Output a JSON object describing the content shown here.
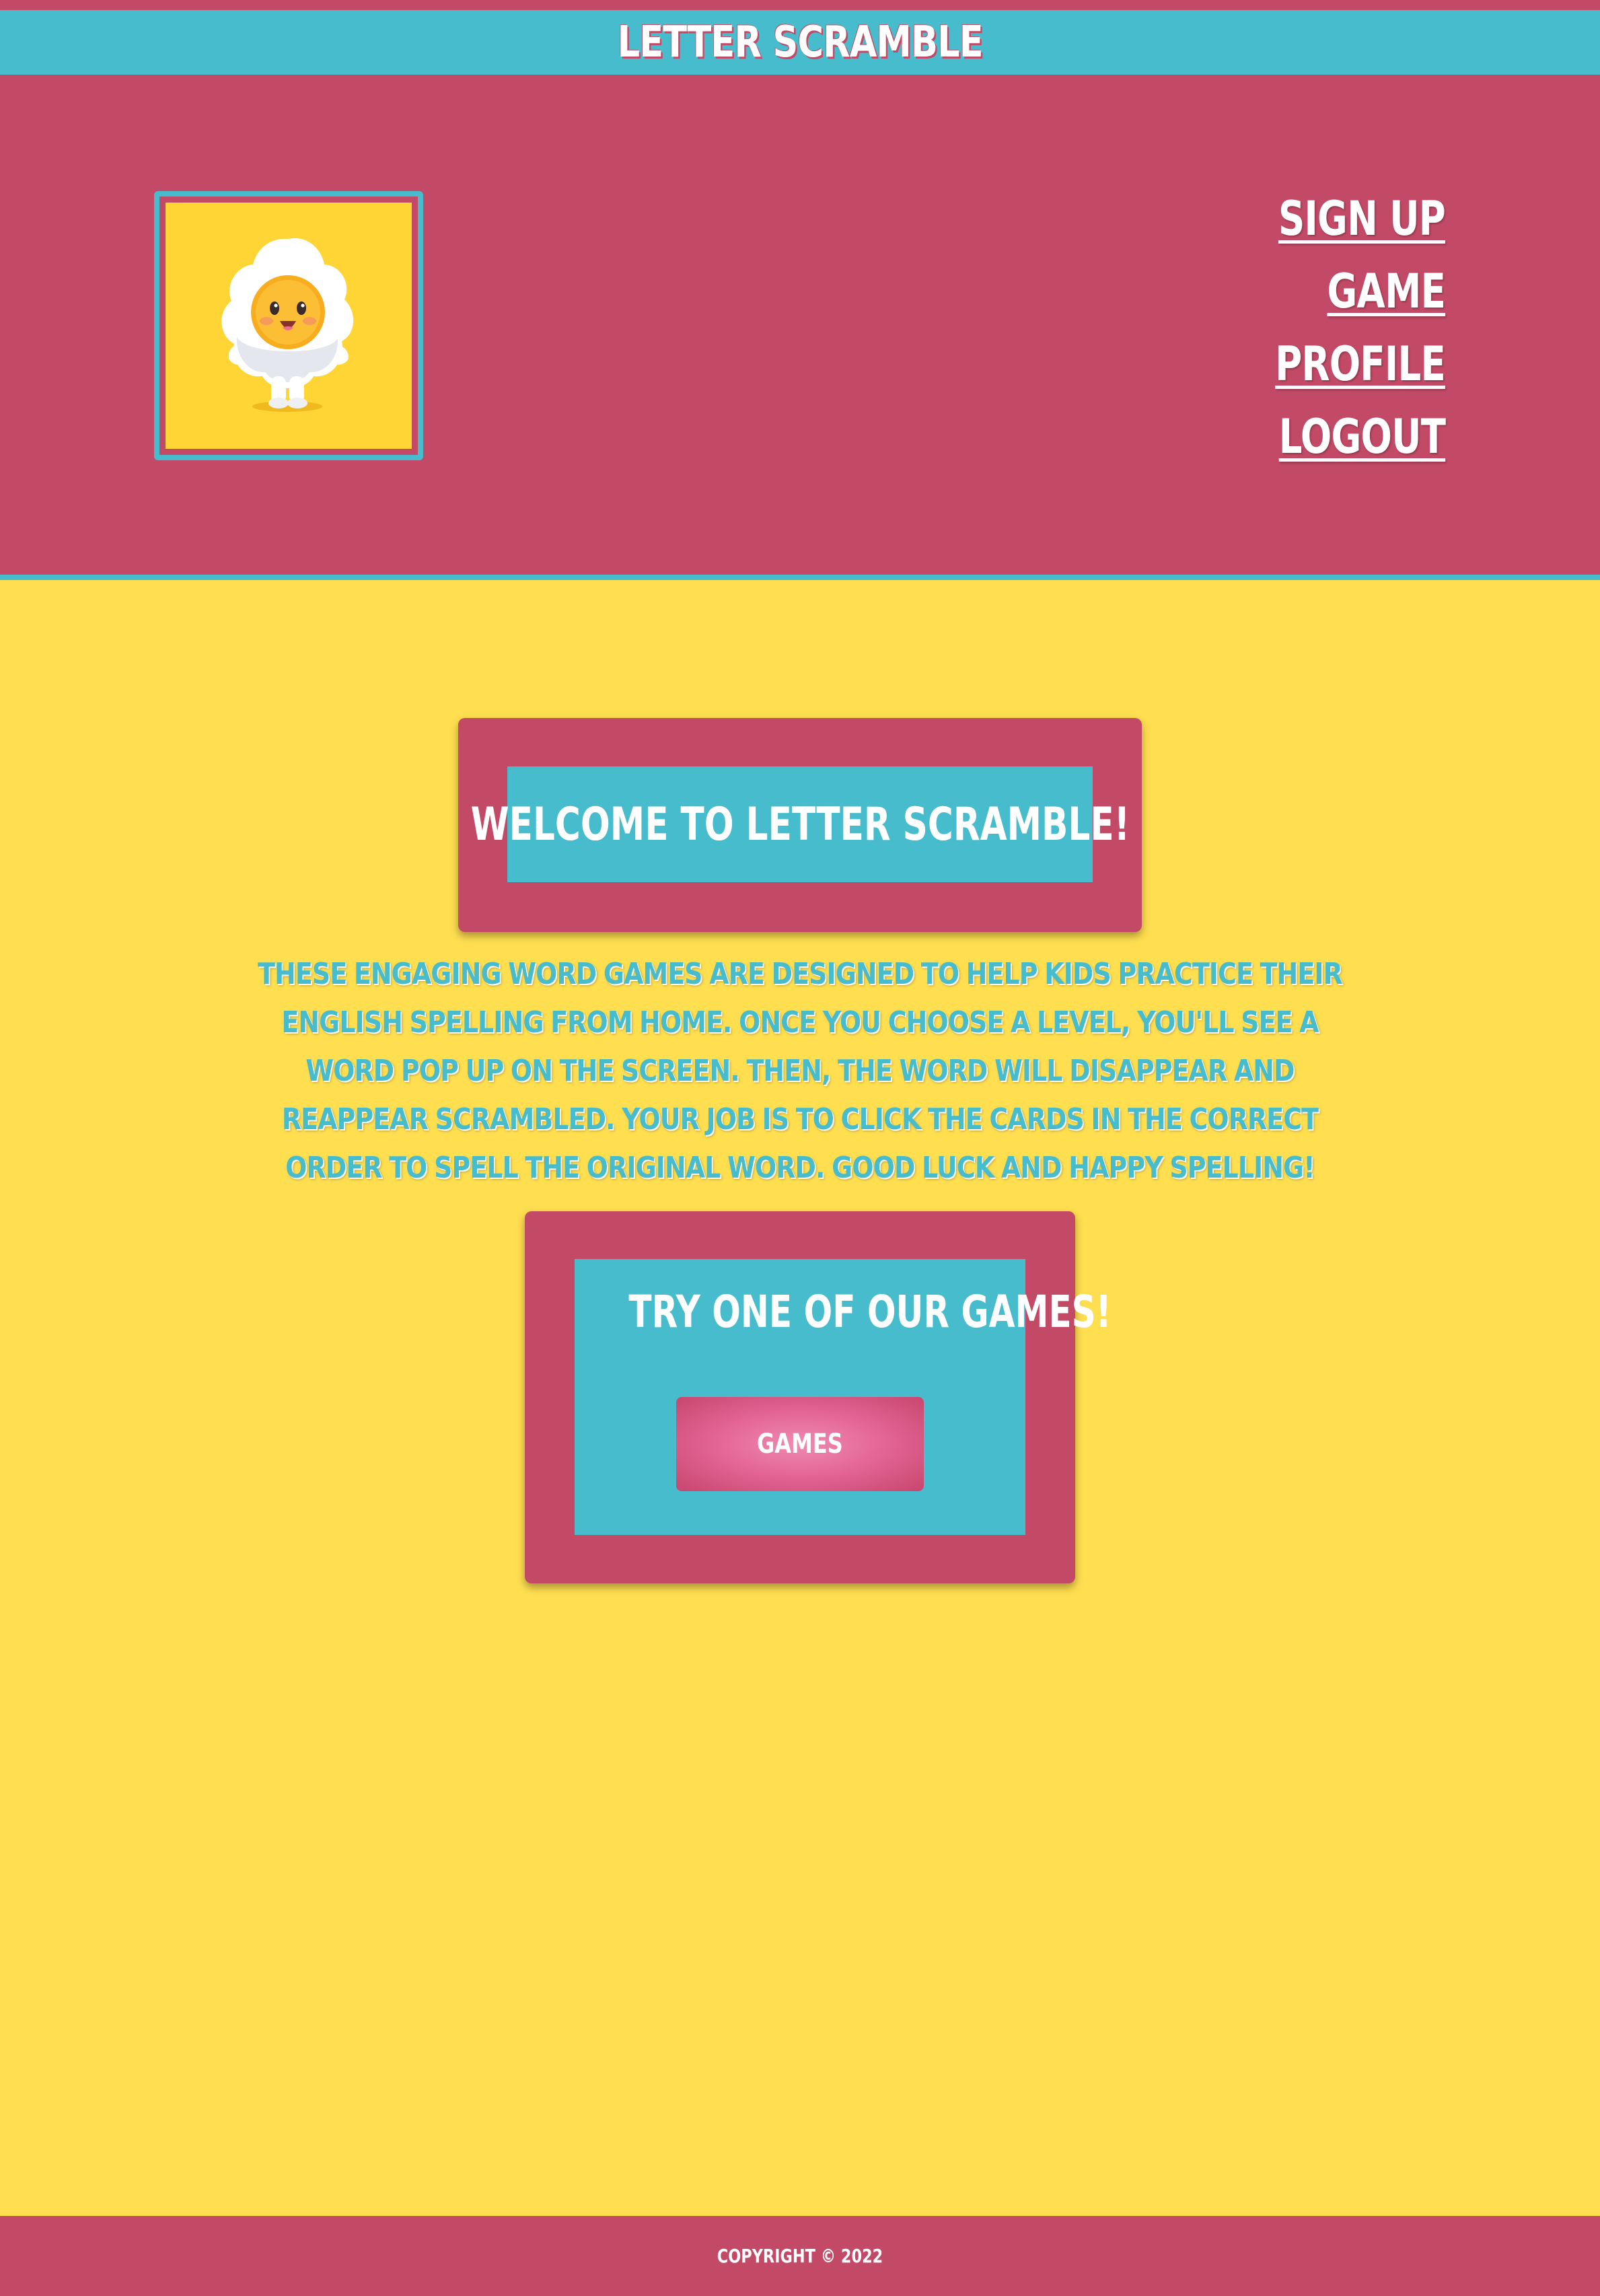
{
  "site": {
    "title": "Letter Scramble"
  },
  "nav": {
    "items": [
      {
        "label": "Sign Up"
      },
      {
        "label": "Game"
      },
      {
        "label": "Profile"
      },
      {
        "label": "Logout"
      }
    ]
  },
  "logo": {
    "icon": "fried-egg-mascot-icon"
  },
  "welcome": {
    "heading": "Welcome to Letter Scramble!"
  },
  "intro": {
    "text": "These engaging word games are designed to help kids practice their English spelling from home. Once you choose a level, you'll see a word pop up on the screen. Then, the word will disappear and reappear scrambled. Your job is to click the cards in the correct order to spell the original word. Good luck and happy spelling!"
  },
  "games_card": {
    "heading": "Try one of our games!",
    "button_label": "Games"
  },
  "footer": {
    "copyright": "Copyright © 2022"
  },
  "colors": {
    "background": "#ffdf50",
    "primary": "#c24a67",
    "accent": "#47bccd",
    "button": "#e46797"
  }
}
